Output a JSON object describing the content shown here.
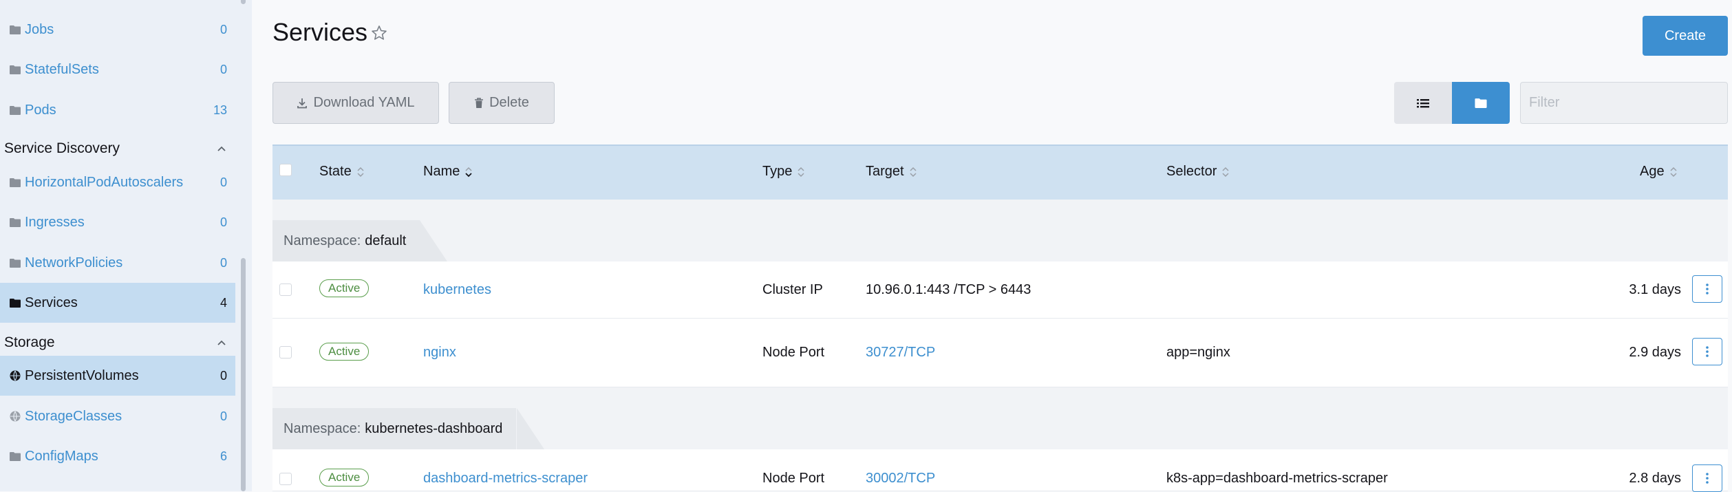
{
  "sidebar": {
    "items_top": [
      {
        "label": "Jobs",
        "count": "0",
        "icon": "folder-icon"
      },
      {
        "label": "StatefulSets",
        "count": "0",
        "icon": "folder-icon"
      },
      {
        "label": "Pods",
        "count": "13",
        "icon": "folder-icon"
      }
    ],
    "group_service_discovery": "Service Discovery",
    "items_service_discovery": [
      {
        "label": "HorizontalPodAutoscalers",
        "count": "0",
        "icon": "folder-icon"
      },
      {
        "label": "Ingresses",
        "count": "0",
        "icon": "folder-icon"
      },
      {
        "label": "NetworkPolicies",
        "count": "0",
        "icon": "folder-icon"
      },
      {
        "label": "Services",
        "count": "4",
        "icon": "folder-icon",
        "active": true
      }
    ],
    "group_storage": "Storage",
    "items_storage": [
      {
        "label": "PersistentVolumes",
        "count": "0",
        "icon": "globe-icon",
        "active": true
      },
      {
        "label": "StorageClasses",
        "count": "0",
        "icon": "globe-icon"
      },
      {
        "label": "ConfigMaps",
        "count": "6",
        "icon": "folder-icon"
      }
    ]
  },
  "header": {
    "title": "Services",
    "create_label": "Create"
  },
  "toolbar": {
    "download_yaml_label": "Download YAML",
    "delete_label": "Delete",
    "filter_placeholder": "Filter"
  },
  "table": {
    "columns": {
      "state": "State",
      "name": "Name",
      "type": "Type",
      "target": "Target",
      "selector": "Selector",
      "age": "Age"
    },
    "groups": [
      {
        "prefix": "Namespace:",
        "name": "default",
        "rows": [
          {
            "state": "Active",
            "name": "kubernetes",
            "type": "Cluster IP",
            "target": "10.96.0.1:443 /TCP > 6443",
            "target_link": false,
            "selector": "",
            "age": "3.1 days"
          },
          {
            "state": "Active",
            "name": "nginx",
            "type": "Node Port",
            "target": "30727/TCP",
            "target_link": true,
            "selector": "app=nginx",
            "age": "2.9 days"
          }
        ]
      },
      {
        "prefix": "Namespace:",
        "name": "kubernetes-dashboard",
        "rows": [
          {
            "state": "Active",
            "name": "dashboard-metrics-scraper",
            "type": "Node Port",
            "target": "30002/TCP",
            "target_link": true,
            "selector": "k8s-app=dashboard-metrics-scraper",
            "age": "2.8 days"
          }
        ]
      }
    ]
  },
  "colors": {
    "accent": "#3d8fd1",
    "active_badge": "#4c8d40",
    "sidebar_bg": "#ebf0f7",
    "sidebar_active": "#c4dcf1",
    "table_header": "#cfe1f1"
  }
}
